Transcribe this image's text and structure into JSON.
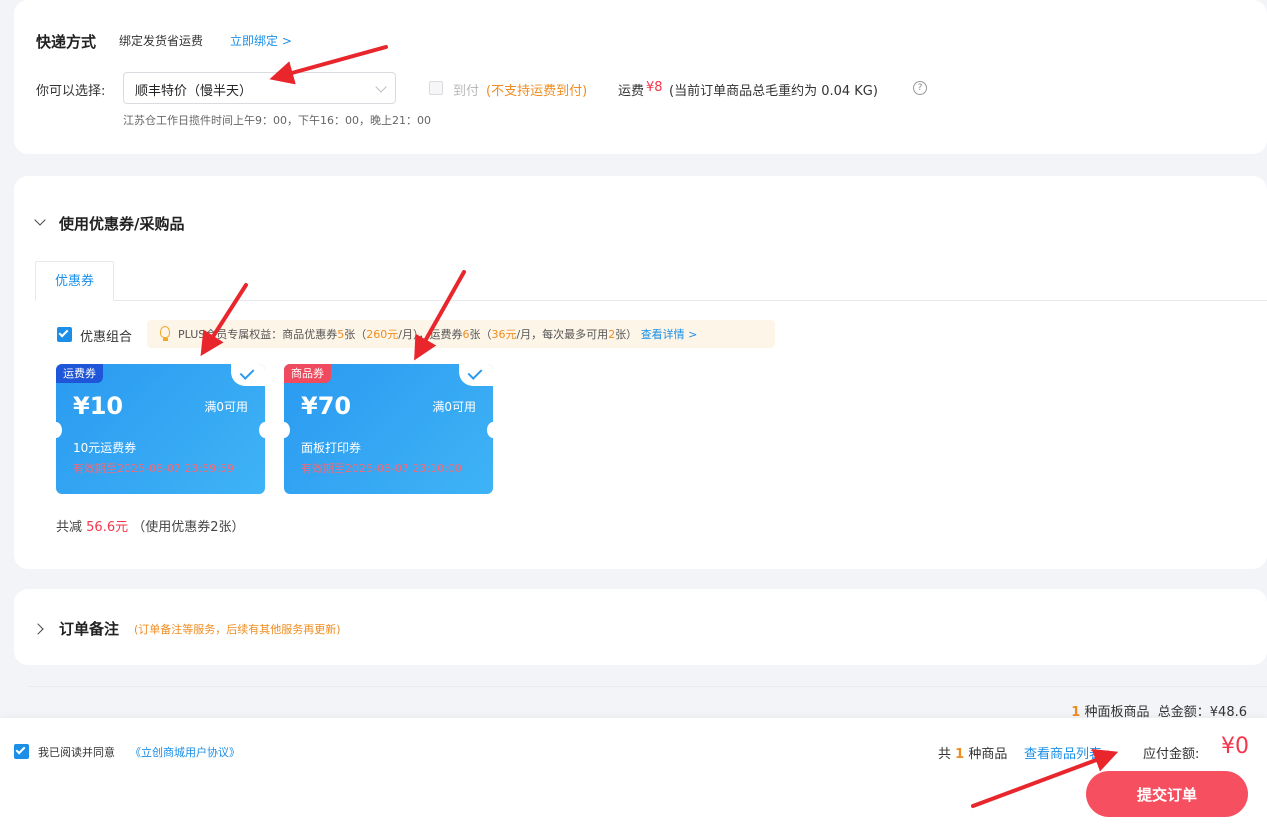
{
  "shipping": {
    "title": "快递方式",
    "bind_label": "绑定发货省运费",
    "bind_link": "立即绑定 >",
    "choose_label": "你可以选择:",
    "selected": "顺丰特价（慢半天）",
    "cod_label": "到付",
    "cod_note": "(不支持运费到付)",
    "freight_label": "运费",
    "freight_value": "¥8",
    "freight_weight": "(当前订单商品总毛重约为 0.04 KG)",
    "pickup_note": "江苏仓工作日揽件时间上午9：00，下午16：00，晚上21：00"
  },
  "coupons": {
    "title": "使用优惠券/采购品",
    "tab_label": "优惠券",
    "combo_label": "优惠组合",
    "plus": {
      "prefix": "PLUS会员专属权益：商品优惠券",
      "goods_count": "5",
      "mid1": "张（",
      "goods_amount": "260元",
      "mid2": "/月），运费券",
      "freight_count": "6",
      "mid3": "张（",
      "freight_amount": "36元",
      "mid4": "/月，每次最多可用",
      "max_use": "2",
      "suffix": "张）",
      "link": "查看详情 >"
    },
    "items": [
      {
        "tag": "运费券",
        "amount": "¥10",
        "condition": "满0可用",
        "name": "10元运费券",
        "valid": "有效期至2025-08-07 23:59:59"
      },
      {
        "tag": "商品券",
        "amount": "¥70",
        "condition": "满0可用",
        "name": "面板打印券",
        "valid": "有效期至2025-08-07 23:10:00"
      }
    ],
    "sum_prefix": "共减",
    "sum_amount": "56.6元",
    "sum_suffix": "（使用优惠券2张）"
  },
  "remark": {
    "title": "订单备注",
    "note": "(订单备注等服务，后续有其他服务再更新)"
  },
  "summary": {
    "count": "1",
    "text": "种面板商品",
    "total_label": "总金额：",
    "total_value": "¥48.6"
  },
  "footer": {
    "agree_label": "我已阅读并同意",
    "agree_link": "《立创商城用户协议》",
    "cart_prefix": "共",
    "cart_count": "1",
    "cart_suffix": "种商品",
    "view_goods": "查看商品列表 >",
    "pay_label": "应付金额:",
    "pay_amount": "¥0",
    "submit_label": "提交订单"
  },
  "colors": {
    "accent": "#1b8fe8",
    "price": "#f5354b",
    "warning": "#f08c1f",
    "annotation_arrow": "#e8262c",
    "submit": "#f54f60"
  }
}
